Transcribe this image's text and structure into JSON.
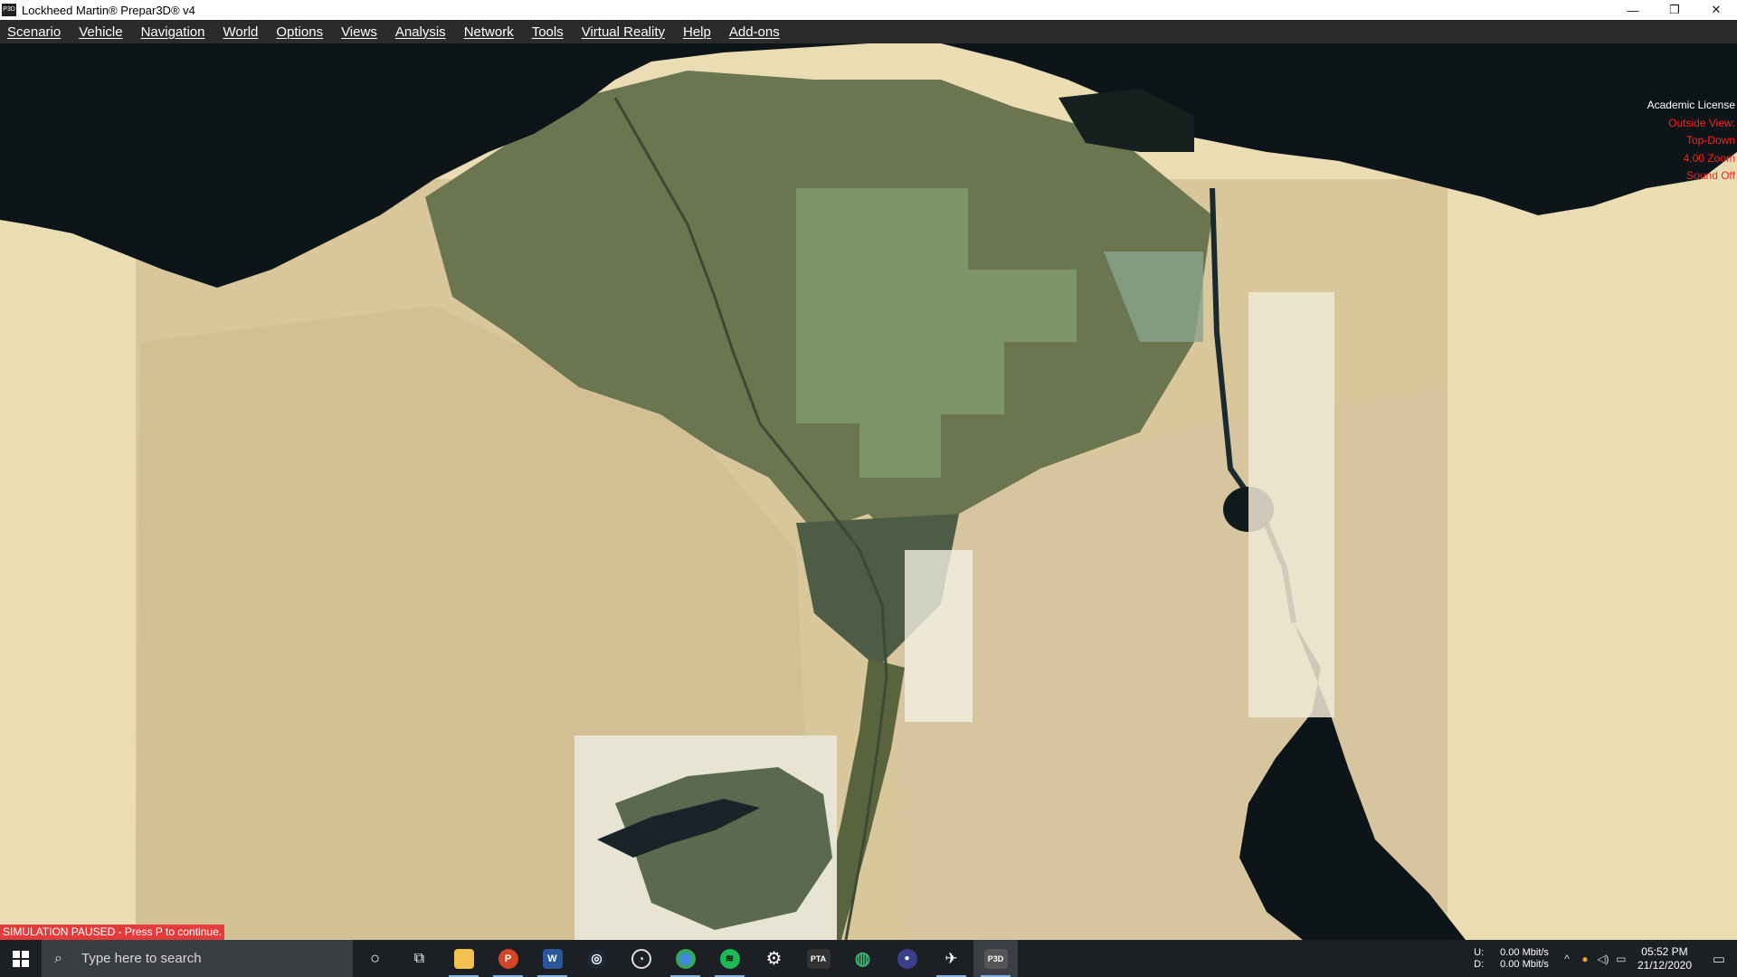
{
  "window": {
    "title": "Lockheed Martin® Prepar3D® v4",
    "app_icon": "P3D",
    "controls": {
      "minimize": "—",
      "restore": "❐",
      "close": "✕"
    }
  },
  "menu": [
    "Scenario",
    "Vehicle",
    "Navigation",
    "World",
    "Options",
    "Views",
    "Analysis",
    "Network",
    "Tools",
    "Virtual Reality",
    "Help",
    "Add-ons"
  ],
  "hud": {
    "license": "Academic License",
    "lines": [
      "Outside View:",
      "Top-Down",
      "4.00 Zoom",
      "Sound Off"
    ],
    "text_color": "#ff2020"
  },
  "status": {
    "paused": "SIMULATION PAUSED - Press P to continue."
  },
  "taskbar": {
    "search_placeholder": "Type here to search",
    "apps": [
      {
        "name": "cortana-icon",
        "glyph": "○"
      },
      {
        "name": "task-view-icon",
        "glyph": "⧉"
      },
      {
        "name": "file-explorer-icon",
        "glyph": "▬"
      },
      {
        "name": "powerpoint-icon",
        "glyph": "P"
      },
      {
        "name": "word-icon",
        "glyph": "W"
      },
      {
        "name": "steam-icon",
        "glyph": "◎"
      },
      {
        "name": "speedometer-icon",
        "glyph": "◔"
      },
      {
        "name": "chrome-icon",
        "glyph": "◉"
      },
      {
        "name": "spotify-icon",
        "glyph": "≋"
      },
      {
        "name": "settings-icon",
        "glyph": "⚙"
      },
      {
        "name": "pta-icon",
        "glyph": "PTA"
      },
      {
        "name": "globe-app-icon",
        "glyph": "◍"
      },
      {
        "name": "circle-app-icon",
        "glyph": "●"
      },
      {
        "name": "flight-app-icon",
        "glyph": "✈"
      },
      {
        "name": "p3d-icon",
        "glyph": "P3D"
      }
    ],
    "network": {
      "up_label": "U:",
      "down_label": "D:",
      "up": "0.00 Mbit/s",
      "down": "0.00 Mbit/s"
    },
    "clock": {
      "time": "05:52 PM",
      "date": "21/12/2020"
    }
  }
}
